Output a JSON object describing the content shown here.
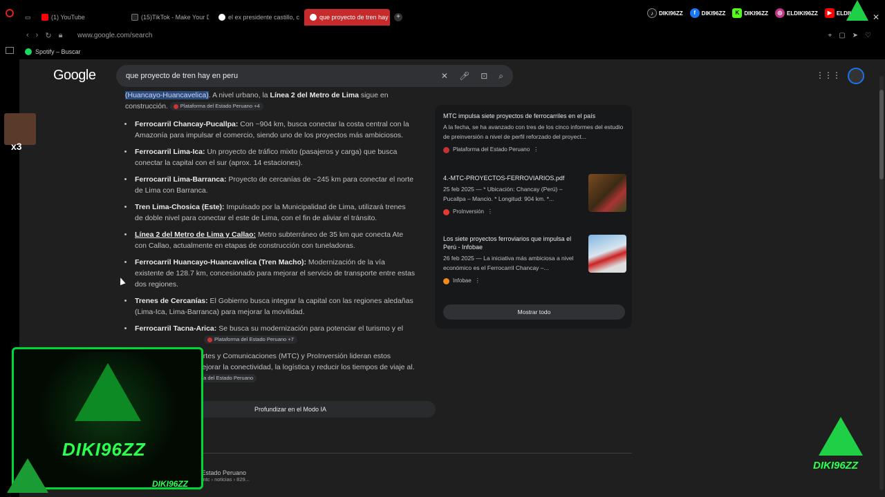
{
  "tabs": [
    {
      "label": "(1) YouTube",
      "icon": "youtube-icon",
      "color": "#ff0000"
    },
    {
      "label": "(15)TikTok - Make Your Da",
      "icon": "tiktok-icon",
      "color": "#ffffff"
    },
    {
      "label": "el ex presidente castillo, c",
      "icon": "google-icon",
      "color": "#4285f4"
    },
    {
      "label": "que proyecto de tren hay",
      "icon": "google-icon",
      "color": "#4285f4"
    }
  ],
  "socials": [
    {
      "name": "DIKI96ZZ",
      "icon": "tiktok-icon",
      "color": "#111111"
    },
    {
      "name": "DIKI96ZZ",
      "icon": "facebook-icon",
      "color": "#1877f2"
    },
    {
      "name": "DIKI96ZZ",
      "icon": "kick-icon",
      "color": "#53fc18"
    },
    {
      "name": "ELDIKI96ZZ",
      "icon": "instagram-icon",
      "color": "#c13584"
    },
    {
      "name": "ELDIKI",
      "icon": "youtube-icon",
      "color": "#ff0000"
    }
  ],
  "address": {
    "url": "www.google.com/search"
  },
  "bookmark": {
    "label": "Spotify – Buscar"
  },
  "search": {
    "query": "que proyecto de tren hay en peru",
    "logo": "Google"
  },
  "ai": {
    "intro_highlight": "(Huancayo-Huancavelica)",
    "intro_text_1": ". A nivel urbano, la ",
    "intro_bold": "Línea 2 del Metro de Lima",
    "intro_text_2": " sigue en construcción.",
    "intro_source": "Plataforma del Estado Peruano +4",
    "items": [
      {
        "title": "Ferrocarril Chancay-Pucallpa:",
        "text": " Con ~904 km, busca conectar la costa central con la Amazonía para impulsar el comercio, siendo uno de los proyectos más ambiciosos."
      },
      {
        "title": "Ferrocarril Lima-Ica:",
        "text": " Un proyecto de tráfico mixto (pasajeros y carga) que busca conectar la capital con el sur (aprox. 14 estaciones)."
      },
      {
        "title": "Ferrocarril Lima-Barranca:",
        "text": " Proyecto de cercanías de ~245 km para conectar el norte de Lima con Barranca."
      },
      {
        "title": "Tren Lima-Chosica (Este):",
        "text": " Impulsado por la Municipalidad de Lima, utilizará trenes de doble nivel para conectar el este de Lima, con el fin de aliviar el tránsito."
      },
      {
        "title": "Línea 2 del Metro de Lima y Callao:",
        "text": " Metro subterráneo de 35 km que conecta Ate con Callao, actualmente en etapas de construcción con tuneladoras."
      },
      {
        "title": "Ferrocarril Huancayo-Huancavelica (Tren Macho):",
        "text": " Modernización de la vía existente de 128.7 km, concesionado para mejorar el servicio de transporte entre estas dos regiones."
      },
      {
        "title": "Trenes de Cercanías:",
        "text": " El Gobierno busca integrar la capital con las regiones aledañas (Lima-Ica, Lima-Barranca) para mejorar la movilidad."
      },
      {
        "title": "Ferrocarril Tacna-Arica:",
        "text": " Se busca su modernización para potenciar el turismo y el"
      }
    ],
    "items_source": "Plataforma del Estado Peruano +7",
    "outro": "e Transportes y Comunicaciones (MTC) y ProInversión lideran estos buscan mejorar la conectividad, la logística y reducir los tiempos de viaje al.",
    "outro_source": "Plataforma del Estado Peruano",
    "dive_button": "Profundizar en el Modo IA"
  },
  "panel": {
    "cards": [
      {
        "title": "MTC impulsa siete proyectos de ferrocarriles en el país",
        "snippet": "A la fecha, se ha avanzado con tres de los cinco informes del estudio de preinversión a nivel de perfil reforzado del proyect...",
        "source": "Plataforma del Estado Peruano",
        "source_color": "#c33333"
      },
      {
        "title": "4.-MTC-PROYECTOS-FERROVIARIOS.pdf",
        "snippet": "25 feb 2025 — * Ubicación: Chancay (Perú) – Pucallpa – Mancio. * Longitud: 904 km. *...",
        "source": "ProInversión",
        "source_color": "#e33b2e"
      },
      {
        "title": "Los siete proyectos ferroviarios que impulsa el Perú - Infobae",
        "snippet": "26 feb 2025 — La iniciativa más ambiciosa a nivel económico es el Ferrocarril Chancay –...",
        "source": "Infobae",
        "source_color": "#f08a1c"
      }
    ],
    "show_all": "Mostrar todo"
  },
  "result": {
    "site": "del Estado Peruano",
    "breadcrumb": "itucion › mtc › noticias › 829..."
  },
  "overlay": {
    "webcam_brand": "DIKI96ZZ",
    "webcam_name": "DIKI96ZZ",
    "corner_brand": "DIKI96ZZ",
    "multiplier": "x3"
  }
}
